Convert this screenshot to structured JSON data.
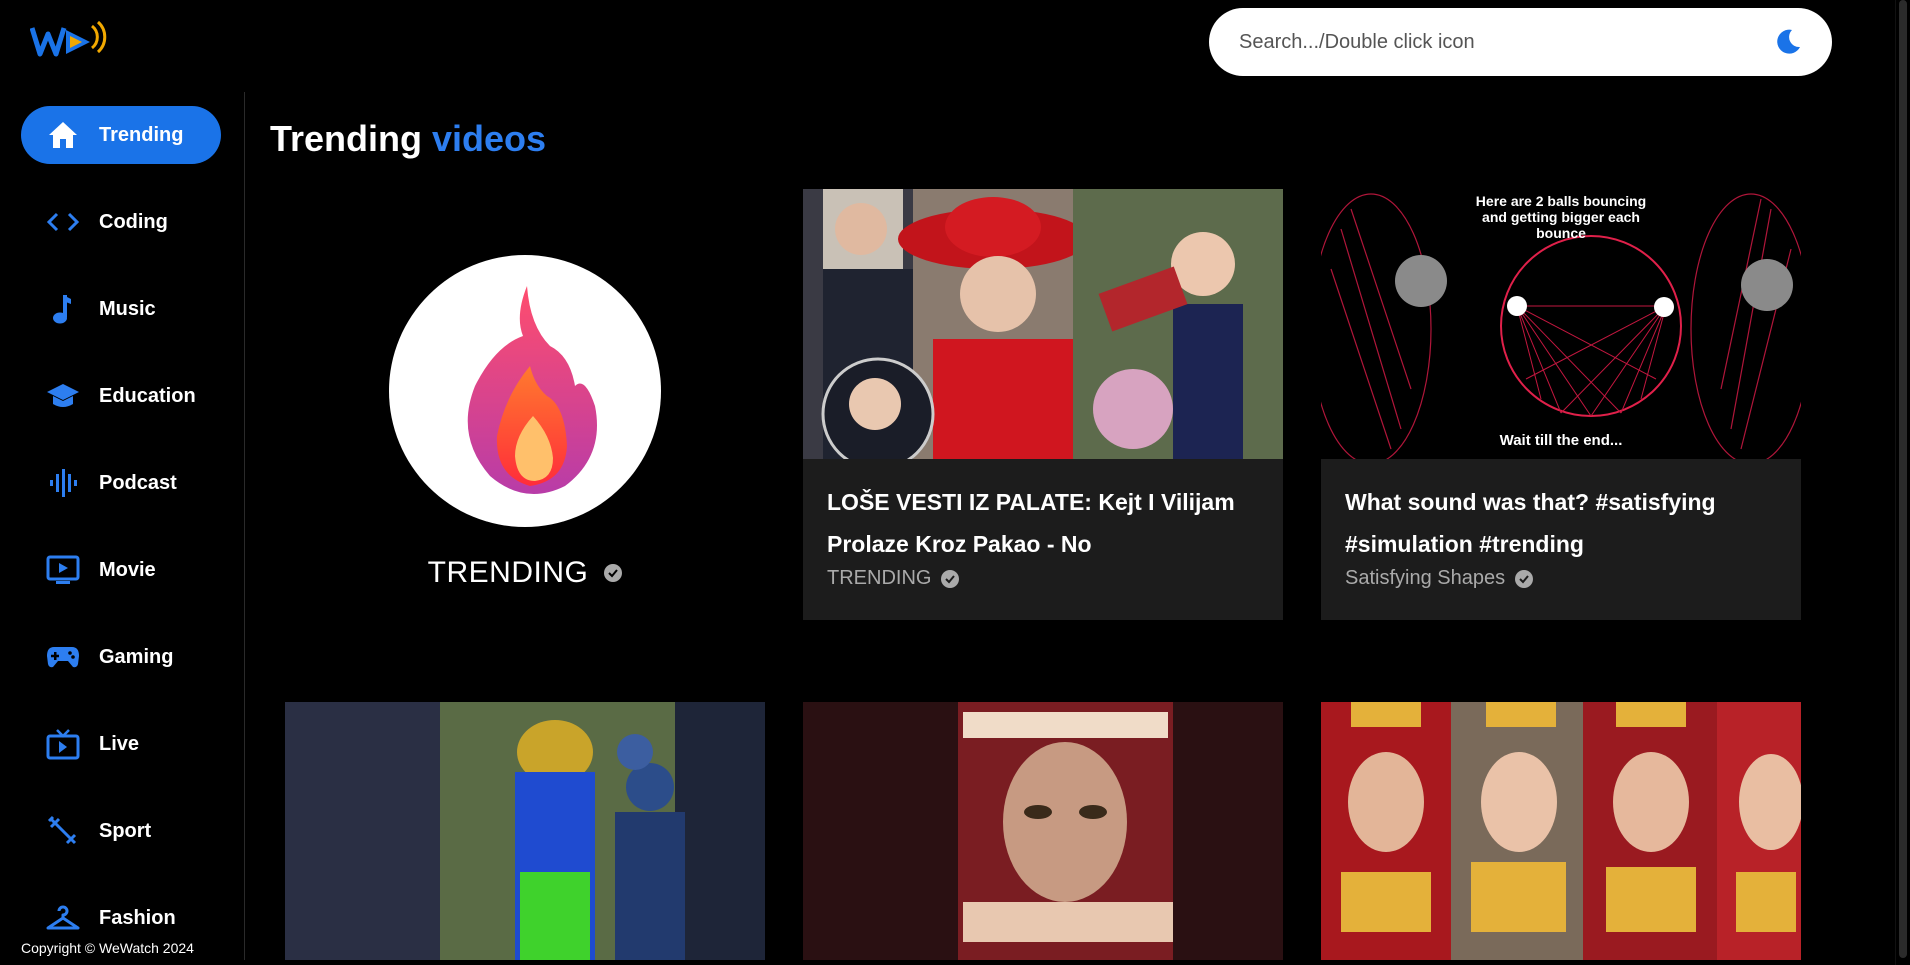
{
  "search": {
    "placeholder": "Search.../Double click icon"
  },
  "sidebar": {
    "items": [
      {
        "label": "Trending",
        "icon": "home-icon"
      },
      {
        "label": "Coding",
        "icon": "code-icon"
      },
      {
        "label": "Music",
        "icon": "music-note-icon"
      },
      {
        "label": "Education",
        "icon": "graduation-cap-icon"
      },
      {
        "label": "Podcast",
        "icon": "audio-wave-icon"
      },
      {
        "label": "Movie",
        "icon": "tv-play-icon"
      },
      {
        "label": "Gaming",
        "icon": "gamepad-icon"
      },
      {
        "label": "Live",
        "icon": "live-tv-icon"
      },
      {
        "label": "Sport",
        "icon": "sport-icon"
      },
      {
        "label": "Fashion",
        "icon": "hanger-icon"
      }
    ],
    "copyright": "Copyright © WeWatch 2024"
  },
  "main": {
    "heading_white": "Trending",
    "heading_accent": "videos",
    "channel": {
      "name": "TRENDING"
    },
    "cards": [
      {
        "title": "LOŠE VESTI IZ PALATE: Kejt I Vilijam Prolaze Kroz Pakao - No",
        "channel": "TRENDING"
      },
      {
        "title": "What sound was that? #satisfying #simulation #trending",
        "channel": "Satisfying Shapes",
        "thumb_text_top": "Here are 2 balls bouncing and getting bigger each bounce",
        "thumb_text_bottom": "Wait till the end..."
      }
    ]
  },
  "colors": {
    "accent": "#1a73e8",
    "card_bg": "#1c1c1c",
    "background": "#000000"
  }
}
